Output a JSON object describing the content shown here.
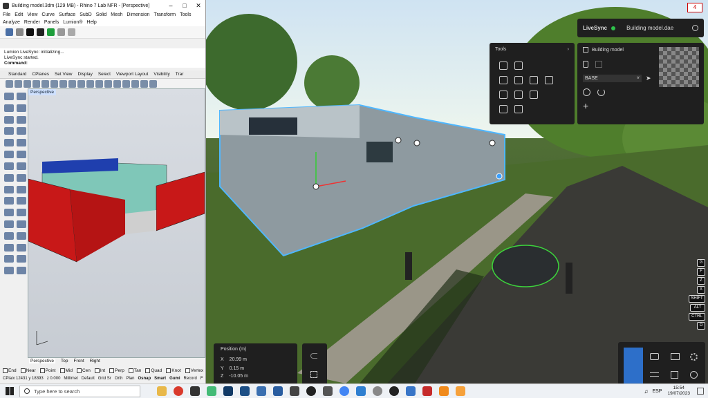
{
  "rhino": {
    "title": "Building model.3dm (129 MB) - Rhino 7 Lab NFR - [Perspective]",
    "menu": [
      "File",
      "Edit",
      "View",
      "Curve",
      "Surface",
      "SubD",
      "Solid",
      "Mesh",
      "Dimension",
      "Transform",
      "Tools",
      "Analyze",
      "Render",
      "Panels",
      "Lumion®",
      "Help"
    ],
    "cmd_lines": [
      "Lumion LiveSync: initializing...",
      "LiveSync started."
    ],
    "command_label": "Command:",
    "tabs": [
      "Standard",
      "CPlanes",
      "Set View",
      "Display",
      "Select",
      "Viewport Layout",
      "Visibility",
      "Trar"
    ],
    "viewport_label": "Perspective",
    "viewport_tabs": [
      "Perspective",
      "Top",
      "Front",
      "Right"
    ],
    "snaps": [
      "End",
      "Near",
      "Point",
      "Mid",
      "Cen",
      "Int",
      "Perp",
      "Tan",
      "Quad",
      "Knot",
      "Vertex"
    ],
    "status": [
      "CPlaix 12431 y 18393",
      "z 0.000",
      "Millimet",
      "Default",
      "Grid Sr",
      "Orth",
      "Plan",
      "Osnap",
      "Smart",
      "Gumi",
      "Record",
      "F"
    ]
  },
  "lumion": {
    "badge": "4",
    "livesync_label": "LiveSync",
    "livesync_file": "Building model.dae",
    "tools_label": "Tools",
    "building_label": "Building model",
    "base_label": "BASE",
    "position_label": "Position (m)",
    "position": {
      "x_label": "X",
      "x": "20.99 m",
      "y_label": "Y",
      "y": "0.15 m",
      "z_label": "Z",
      "z": "-10.05 m"
    },
    "keys": [
      "G",
      "F",
      "Z",
      "X",
      "SHIFT",
      "ALT",
      "CTRL",
      "O"
    ]
  },
  "taskbar": {
    "search_placeholder": "Type here to search",
    "lang": "ESP",
    "time": "15:54",
    "date": "19/07/2023"
  },
  "colors": {
    "accent": "#2d6fc9",
    "livesync_green": "#2ec24b",
    "house_red": "#c81818",
    "selection_blue": "#3aa0ff"
  }
}
